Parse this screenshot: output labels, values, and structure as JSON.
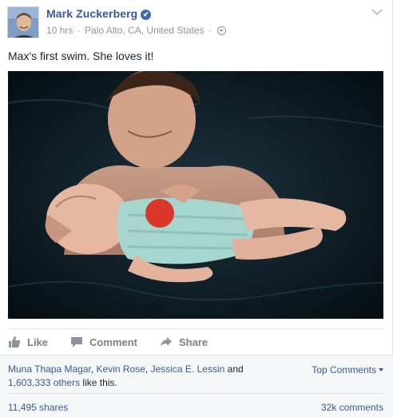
{
  "post": {
    "author": "Mark Zuckerberg",
    "timestamp": "10 hrs",
    "location": "Palo Alto, CA, United States",
    "separator": "·",
    "text": "Max's first swim. She loves it!",
    "verified_icon": "check-icon",
    "privacy_icon": "globe-icon"
  },
  "actions": {
    "like": "Like",
    "comment": "Comment",
    "share": "Share"
  },
  "social": {
    "liker_1": "Muna Thapa Magar",
    "liker_2": "Kevin Rose",
    "liker_3": "Jessica E. Lessin",
    "and": "and",
    "others_count": "1,603,333 others",
    "like_suffix": "like this.",
    "top_comments": "Top Comments",
    "shares": "11,495 shares",
    "comments": "32k comments"
  },
  "colors": {
    "link_blue": "#365899",
    "meta_gray": "#90949c",
    "action_gray": "#7f7f7f",
    "panel_bg": "#f6f7f9"
  }
}
